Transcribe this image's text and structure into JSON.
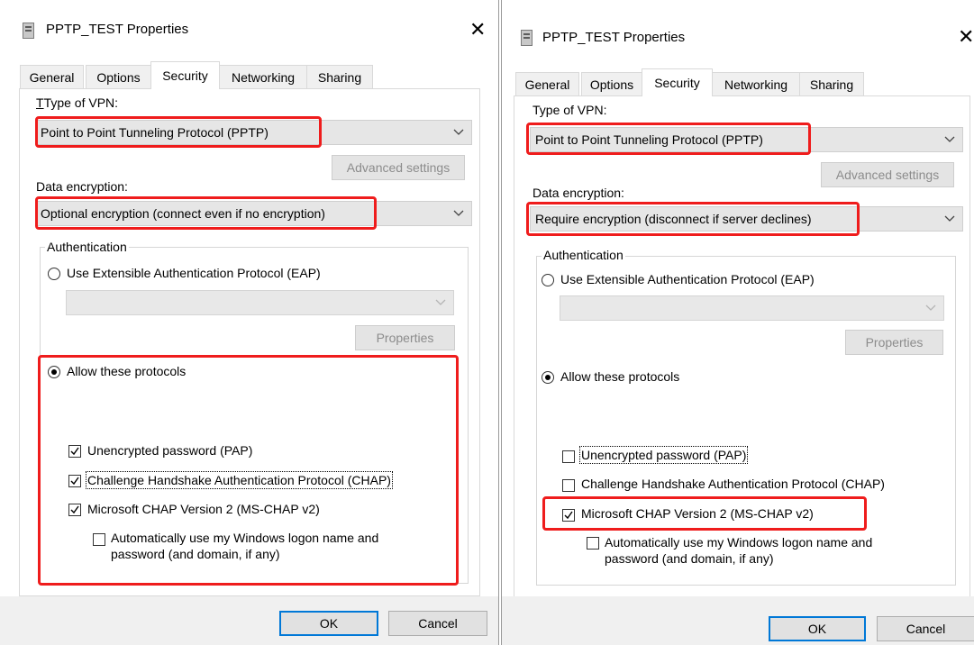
{
  "dialogs": [
    {
      "title": "PPTP_TEST Properties",
      "tabs": [
        "General",
        "Options",
        "Security",
        "Networking",
        "Sharing"
      ],
      "active_tab": "Security",
      "vpn_type_label": "Type of VPN:",
      "vpn_type_value": "Point to Point Tunneling Protocol (PPTP)",
      "advanced_settings_label": "Advanced settings",
      "data_encryption_label": "Data encryption:",
      "data_encryption_value": "Optional encryption (connect even if no encryption)",
      "authentication_label": "Authentication",
      "eap_label": "Use Extensible Authentication Protocol (EAP)",
      "eap_selected": false,
      "properties_label": "Properties",
      "allow_protocols_label": "Allow these protocols",
      "allow_protocols_selected": true,
      "protocols": [
        {
          "label": "Unencrypted password (PAP)",
          "checked": true
        },
        {
          "label": "Challenge Handshake Authentication Protocol (CHAP)",
          "checked": true
        },
        {
          "label": "Microsoft CHAP Version 2 (MS-CHAP v2)",
          "checked": true
        }
      ],
      "auto_logon_line1": "Automatically use my Windows logon name and",
      "auto_logon_line2": "password (and domain, if any)",
      "auto_logon_checked": false,
      "ok_label": "OK",
      "cancel_label": "Cancel"
    },
    {
      "title": "PPTP_TEST Properties",
      "tabs": [
        "General",
        "Options",
        "Security",
        "Networking",
        "Sharing"
      ],
      "active_tab": "Security",
      "vpn_type_label": "Type of VPN:",
      "vpn_type_value": "Point to Point Tunneling Protocol (PPTP)",
      "advanced_settings_label": "Advanced settings",
      "data_encryption_label": "Data encryption:",
      "data_encryption_value": "Require encryption (disconnect if server declines)",
      "authentication_label": "Authentication",
      "eap_label": "Use Extensible Authentication Protocol (EAP)",
      "eap_selected": false,
      "properties_label": "Properties",
      "allow_protocols_label": "Allow these protocols",
      "allow_protocols_selected": true,
      "protocols": [
        {
          "label": "Unencrypted password (PAP)",
          "checked": false
        },
        {
          "label": "Challenge Handshake Authentication Protocol (CHAP)",
          "checked": false
        },
        {
          "label": "Microsoft CHAP Version 2 (MS-CHAP v2)",
          "checked": true
        }
      ],
      "auto_logon_line1": "Automatically use my Windows logon name and",
      "auto_logon_line2": "password (and domain, if any)",
      "auto_logon_checked": false,
      "ok_label": "OK",
      "cancel_label": "Cancel"
    }
  ],
  "colors": {
    "highlight": "#ef1c1c",
    "default_button_border": "#0078d7",
    "footer_background": "#f0f0f0"
  }
}
